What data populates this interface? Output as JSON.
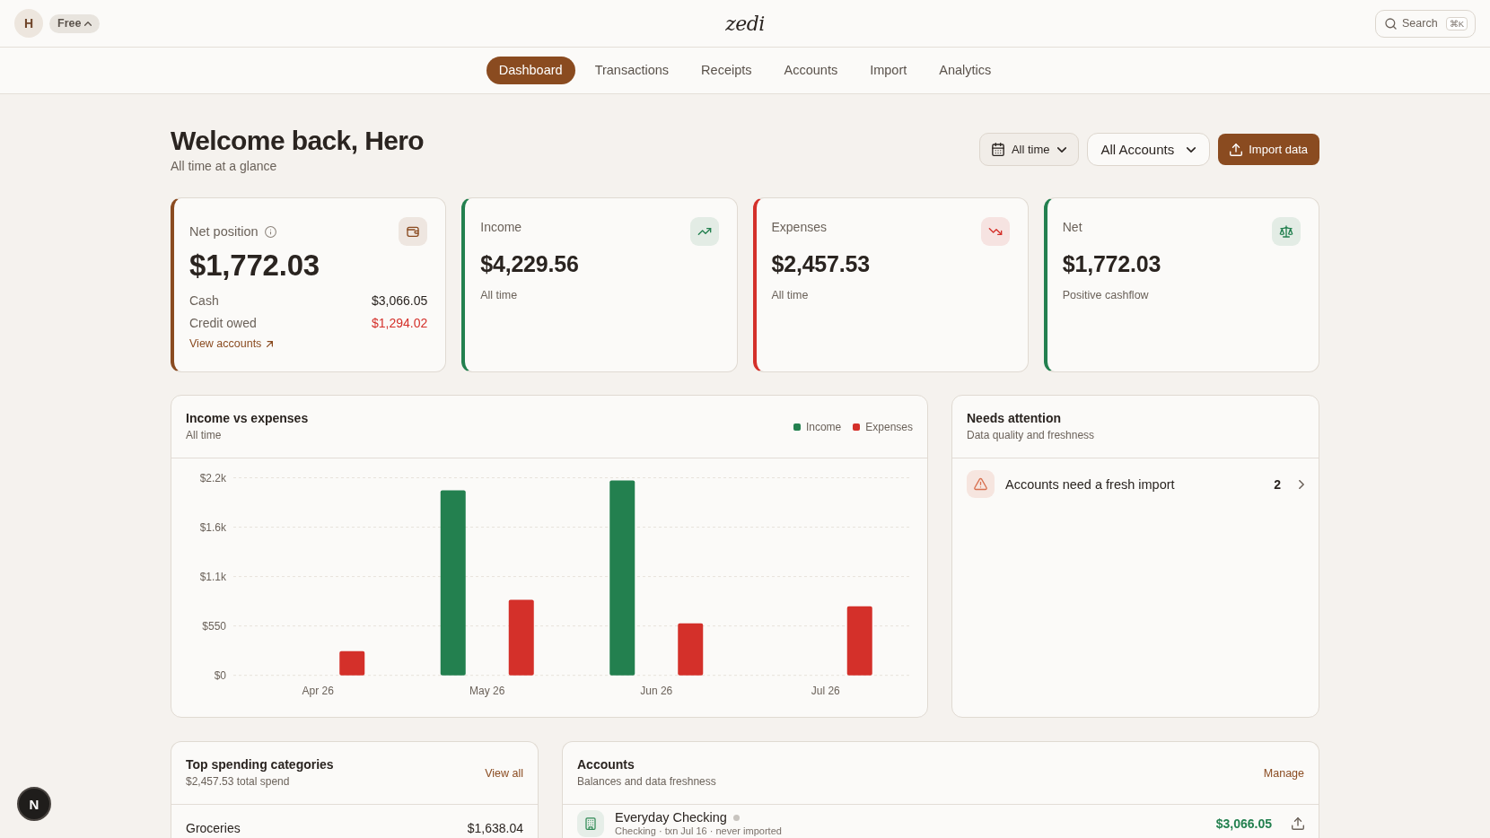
{
  "topbar": {
    "avatar": "H",
    "plan": "Free",
    "logo": "zedi",
    "search": {
      "label": "Search",
      "shortcut": "⌘K"
    }
  },
  "tabs": [
    {
      "label": "Dashboard",
      "selected": true
    },
    {
      "label": "Transactions",
      "selected": false
    },
    {
      "label": "Receipts",
      "selected": false
    },
    {
      "label": "Accounts",
      "selected": false
    },
    {
      "label": "Import",
      "selected": false
    },
    {
      "label": "Analytics",
      "selected": false
    }
  ],
  "header": {
    "title": "Welcome back, Hero",
    "subtitle": "All time at a glance",
    "period": "All time",
    "account_filter": "All Accounts",
    "import_button": "Import data"
  },
  "stat_cards": [
    {
      "kind": "balance",
      "label": "Net position",
      "value": "$1,772.03",
      "color": "#8a4b20",
      "rows": [
        {
          "label": "Cash",
          "value": "$3,066.05",
          "negative": false
        },
        {
          "label": "Credit owed",
          "value": "$1,294.02",
          "negative": true
        }
      ],
      "link": "View accounts"
    },
    {
      "kind": "income",
      "label": "Income",
      "value": "$4,229.56",
      "note": "All time",
      "color": "#23804f"
    },
    {
      "kind": "expense",
      "label": "Expenses",
      "value": "$2,457.53",
      "note": "All time",
      "color": "#d4302a"
    },
    {
      "kind": "net",
      "label": "Net",
      "value": "$1,772.03",
      "note": "Positive cashflow",
      "color": "#23804f"
    }
  ],
  "income_chart": {
    "title": "Income vs expenses",
    "subtitle": "All time",
    "chart_data": {
      "type": "bar",
      "categories": [
        "Apr 26",
        "May 26",
        "Jun 26",
        "Jul 26"
      ],
      "series": [
        {
          "name": "Income",
          "color": "#23804f",
          "values": [
            0,
            2060,
            2170,
            0
          ]
        },
        {
          "name": "Expenses",
          "color": "#d4302a",
          "values": [
            270,
            840,
            580,
            770
          ]
        }
      ],
      "ylim": [
        0,
        2200
      ],
      "yticks": [
        {
          "value": 0,
          "label": "$0"
        },
        {
          "value": 550,
          "label": "$550"
        },
        {
          "value": 1100,
          "label": "$1.1k"
        },
        {
          "value": 1650,
          "label": "$1.6k"
        },
        {
          "value": 2200,
          "label": "$2.2k"
        }
      ],
      "grid": true
    }
  },
  "attention": {
    "title": "Needs attention",
    "subtitle": "Data quality and freshness",
    "items": [
      {
        "label": "Accounts need a fresh import",
        "count": "2"
      }
    ]
  },
  "spending": {
    "title": "Top spending categories",
    "subtitle": "$2,457.53 total spend",
    "link": "View all",
    "categories": [
      {
        "name": "Groceries",
        "amount": "$1,638.04"
      }
    ]
  },
  "accounts": {
    "title": "Accounts",
    "subtitle": "Balances and data freshness",
    "link": "Manage",
    "items": [
      {
        "name": "Everyday Checking",
        "color": "#c8c4bf",
        "details": "Checking · txn Jul 16 · never imported",
        "balance": "$3,066.05",
        "negative": false
      }
    ]
  },
  "dev_badge": {
    "label": "N"
  }
}
